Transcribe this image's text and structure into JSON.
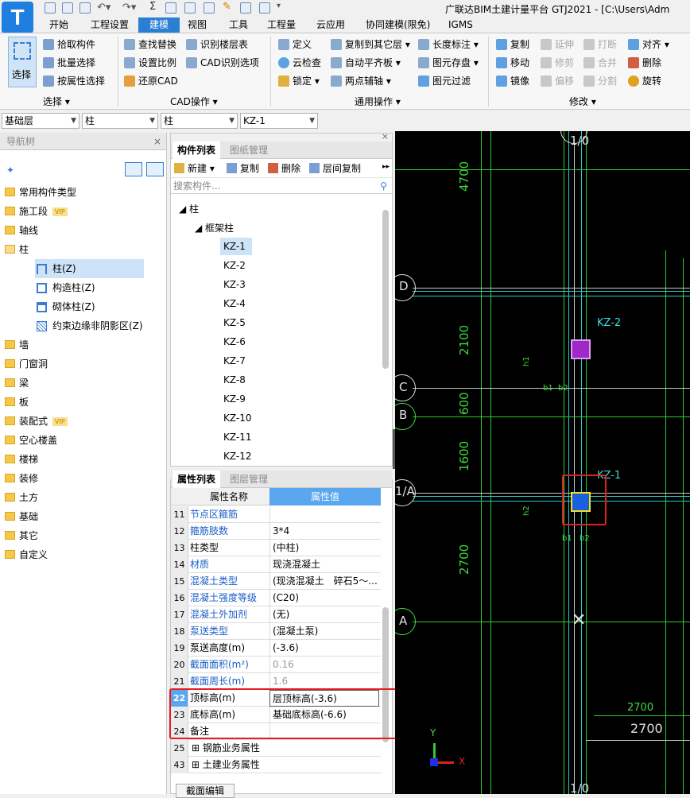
{
  "app": {
    "title": "广联达BIM土建计量平台 GTJ2021 - [C:\\Users\\Adm",
    "logo": "T"
  },
  "menu": [
    "开始",
    "工程设置",
    "建模",
    "视图",
    "工具",
    "工程量",
    "云应用",
    "协同建模(限免)",
    "IGMS"
  ],
  "ribbon": {
    "select_label": "选择",
    "select_group": {
      "items": [
        "拾取构件",
        "批量选择",
        "按属性选择"
      ],
      "label": "选择"
    },
    "cad_group": {
      "items": [
        "查找替换",
        "识别楼层表",
        "设置比例",
        "CAD识别选项",
        "还原CAD"
      ],
      "label": "CAD操作"
    },
    "common_group": {
      "items": [
        "定义",
        "复制到其它层",
        "长度标注",
        "云检查",
        "自动平齐板",
        "图元存盘",
        "锁定",
        "两点辅轴",
        "图元过滤"
      ],
      "label": "通用操作"
    },
    "modify_group": {
      "items": [
        "复制",
        "延伸",
        "打断",
        "对齐",
        "移动",
        "修剪",
        "合并",
        "删除",
        "镜像",
        "偏移",
        "分割",
        "旋转"
      ],
      "label": "修改"
    }
  },
  "layer_bar": {
    "floor": "基础层",
    "category": "柱",
    "type": "柱",
    "component": "KZ-1"
  },
  "nav": {
    "title": "导航树",
    "items": [
      {
        "label": "常用构件类型"
      },
      {
        "label": "施工段",
        "vip": "VIP"
      },
      {
        "label": "轴线"
      },
      {
        "label": "柱"
      },
      {
        "label": "墙"
      },
      {
        "label": "门窗洞"
      },
      {
        "label": "梁"
      },
      {
        "label": "板"
      },
      {
        "label": "装配式",
        "vip": "VIP"
      },
      {
        "label": "空心楼盖"
      },
      {
        "label": "楼梯"
      },
      {
        "label": "装修"
      },
      {
        "label": "土方"
      },
      {
        "label": "基础"
      },
      {
        "label": "其它"
      },
      {
        "label": "自定义"
      }
    ],
    "column_children": [
      "柱(Z)",
      "构造柱(Z)",
      "砌体柱(Z)",
      "约束边缘非阴影区(Z)"
    ]
  },
  "component_list": {
    "tabs": [
      "构件列表",
      "图纸管理"
    ],
    "toolbar": [
      "新建",
      "复制",
      "删除",
      "层间复制"
    ],
    "search_placeholder": "搜索构件...",
    "tree_root": "柱",
    "tree_group": "框架柱",
    "items": [
      "KZ-1",
      "KZ-2",
      "KZ-3",
      "KZ-4",
      "KZ-5",
      "KZ-6",
      "KZ-7",
      "KZ-8",
      "KZ-9",
      "KZ-10",
      "KZ-11",
      "KZ-12"
    ],
    "selected": "KZ-1"
  },
  "properties": {
    "tabs": [
      "属性列表",
      "图层管理"
    ],
    "col_name": "属性名称",
    "col_value": "属性值",
    "rows": [
      {
        "num": "11",
        "name": "节点区箍筋",
        "value": ""
      },
      {
        "num": "12",
        "name": "箍筋肢数",
        "value": "3*4"
      },
      {
        "num": "13",
        "name": "柱类型",
        "value": "(中柱)"
      },
      {
        "num": "14",
        "name": "材质",
        "value": "现浇混凝土"
      },
      {
        "num": "15",
        "name": "混凝土类型",
        "value": "(现浇混凝土　碎石5～..."
      },
      {
        "num": "16",
        "name": "混凝土强度等级",
        "value": "(C20)"
      },
      {
        "num": "17",
        "name": "混凝土外加剂",
        "value": "(无)"
      },
      {
        "num": "18",
        "name": "泵送类型",
        "value": "(混凝土泵)"
      },
      {
        "num": "19",
        "name": "泵送高度(m)",
        "value": "(-3.6)"
      },
      {
        "num": "20",
        "name": "截面面积(m²)",
        "value": "0.16"
      },
      {
        "num": "21",
        "name": "截面周长(m)",
        "value": "1.6"
      },
      {
        "num": "22",
        "name": "顶标高(m)",
        "value": "层顶标高(-3.6)"
      },
      {
        "num": "23",
        "name": "底标高(m)",
        "value": "基础底标高(-6.6)"
      },
      {
        "num": "24",
        "name": "备注",
        "value": ""
      },
      {
        "num": "25",
        "name": "钢筋业务属性",
        "value": ""
      },
      {
        "num": "43",
        "name": "土建业务属性",
        "value": ""
      }
    ],
    "bottom_button": "截面编辑"
  },
  "canvas": {
    "axis_top": "1/0",
    "axis_bottom": "1/0",
    "axes": [
      "D",
      "C",
      "B",
      "1/A",
      "A"
    ],
    "dims": [
      "4700",
      "2100",
      "600",
      "1600",
      "2700"
    ],
    "column_labels": [
      "KZ-2",
      "KZ-1"
    ],
    "bottom_dim": "2700",
    "bottom_dim_large": "2700",
    "beam_labels": [
      "b1",
      "b2",
      "h1",
      "h2"
    ],
    "ucs_y": "Y",
    "ucs_x": "X",
    "colors": {
      "grid": "#2ecc2e",
      "kz2": "#b030d0",
      "kz1": "#1a5fe0",
      "highlight": "#e41e1e"
    }
  }
}
